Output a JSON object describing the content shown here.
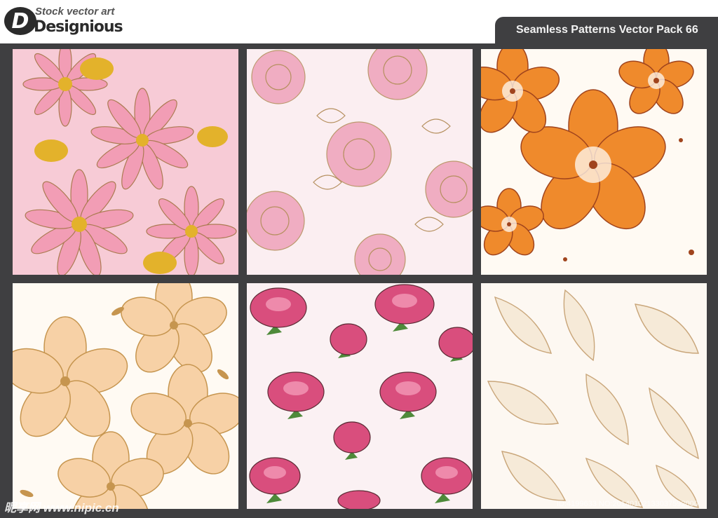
{
  "logo": {
    "tagline": "Stock vector art",
    "mark": "Designious",
    "badge": "D"
  },
  "title": "Seamless Patterns Vector Pack 66",
  "patterns": [
    {
      "name": "pink-daisy-pattern",
      "colors": {
        "bg": "#f7cbd6",
        "petal": "#f29bb4",
        "center": "#e3b22b",
        "line": "#a9774b"
      }
    },
    {
      "name": "pink-rose-pattern",
      "colors": {
        "bg": "#fbeef1",
        "petal": "#efa7bd",
        "line": "#b58f5e"
      }
    },
    {
      "name": "orange-hibiscus-pattern",
      "colors": {
        "bg": "#fffaf3",
        "petal": "#ef8a2c",
        "line": "#a0441d"
      }
    },
    {
      "name": "peach-blossom-pattern",
      "colors": {
        "bg": "#fffaf3",
        "petal": "#f7d1a6",
        "line": "#c6954f"
      }
    },
    {
      "name": "magenta-peony-pattern",
      "colors": {
        "bg": "#fbf1f3",
        "petal": "#d94e7d",
        "leaf": "#4e8a3a",
        "line": "#5a2a33"
      }
    },
    {
      "name": "cream-lily-pattern",
      "colors": {
        "bg": "#fdf8f2",
        "petal": "#f6ead8",
        "line": "#c9a67a"
      }
    }
  ],
  "watermark": {
    "site": "昵享网 www.nipic.cn",
    "id": "ID:4199633 NO:20140102133037592000"
  }
}
